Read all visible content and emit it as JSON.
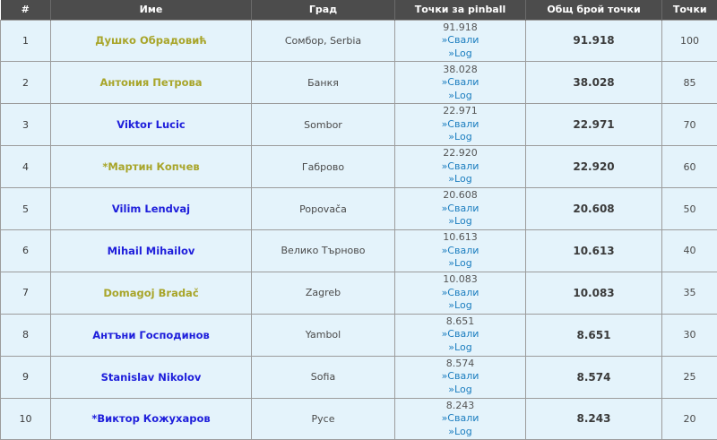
{
  "headers": {
    "num": "#",
    "name": "Име",
    "city": "Град",
    "pinball": "Точки за pinball",
    "total": "Общ брой точки",
    "points": "Точки"
  },
  "links": {
    "download": "»Свали",
    "log": "»Log"
  },
  "colors": {
    "header_bg": "#4c4c4c",
    "row_bg": "#e4f3fb",
    "name_olive": "#a8a52a",
    "name_blue": "#1e1edb",
    "link": "#1b7dbf"
  },
  "rows": [
    {
      "rank": "1",
      "name": "Душко Обрадовић",
      "name_color": "olive",
      "city": "Сомбор, Serbia",
      "pinball": "91.918",
      "total": "91.918",
      "points": "100"
    },
    {
      "rank": "2",
      "name": "Антония Петрова",
      "name_color": "olive",
      "city": "Банкя",
      "pinball": "38.028",
      "total": "38.028",
      "points": "85"
    },
    {
      "rank": "3",
      "name": "Viktor Lucic",
      "name_color": "blue",
      "city": "Sombor",
      "pinball": "22.971",
      "total": "22.971",
      "points": "70"
    },
    {
      "rank": "4",
      "name": "*Мартин Копчев",
      "name_color": "olive",
      "city": "Габрово",
      "pinball": "22.920",
      "total": "22.920",
      "points": "60"
    },
    {
      "rank": "5",
      "name": "Vilim Lendvaj",
      "name_color": "blue",
      "city": "Popovača",
      "pinball": "20.608",
      "total": "20.608",
      "points": "50"
    },
    {
      "rank": "6",
      "name": "Mihail Mihailov",
      "name_color": "blue",
      "city": "Велико Търново",
      "pinball": "10.613",
      "total": "10.613",
      "points": "40"
    },
    {
      "rank": "7",
      "name": "Domagoj Bradač",
      "name_color": "olive",
      "city": "Zagreb",
      "pinball": "10.083",
      "total": "10.083",
      "points": "35"
    },
    {
      "rank": "8",
      "name": "Антъни Господинов",
      "name_color": "blue",
      "city": "Yambol",
      "pinball": "8.651",
      "total": "8.651",
      "points": "30"
    },
    {
      "rank": "9",
      "name": "Stanislav Nikolov",
      "name_color": "blue",
      "city": "Sofia",
      "pinball": "8.574",
      "total": "8.574",
      "points": "25"
    },
    {
      "rank": "10",
      "name": "*Виктор Кожухаров",
      "name_color": "blue",
      "city": "Русе",
      "pinball": "8.243",
      "total": "8.243",
      "points": "20"
    }
  ]
}
